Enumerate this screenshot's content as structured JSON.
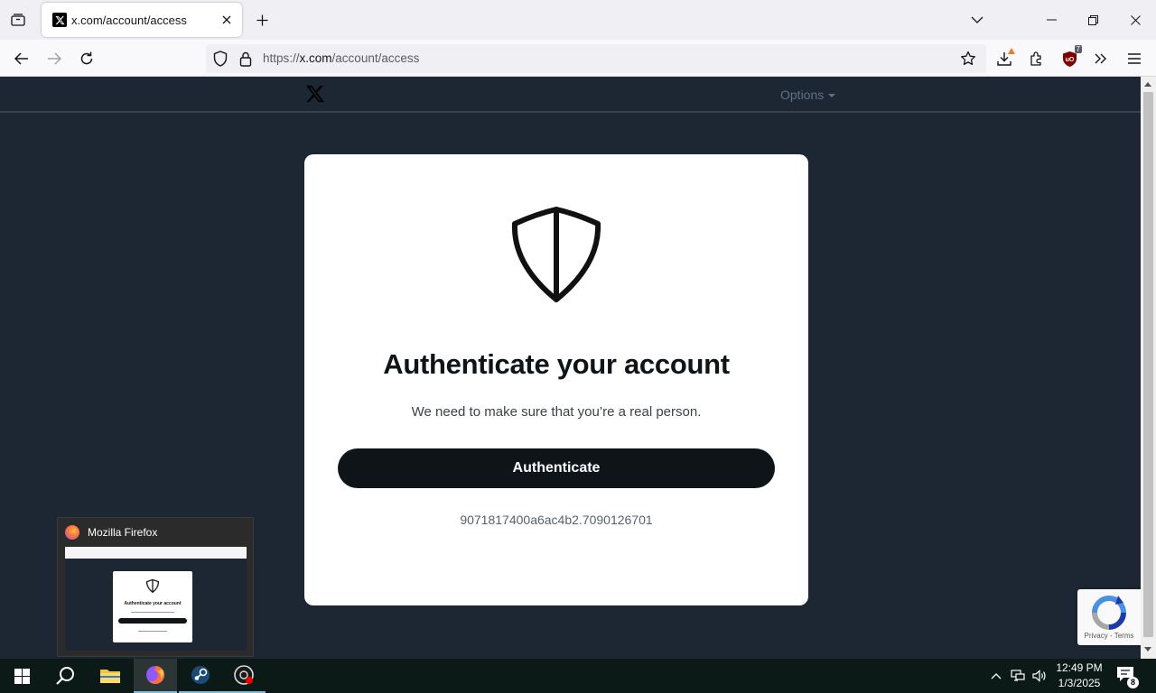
{
  "browser": {
    "tab": {
      "title": "x.com/account/access"
    },
    "url": {
      "scheme": "https://",
      "host": "x.com",
      "path": "/account/access"
    },
    "extensions": {
      "ublock_badge": "7"
    }
  },
  "site": {
    "options_label": "Options"
  },
  "card": {
    "title": "Authenticate your account",
    "subtitle": "We need to make sure that you’re a real person.",
    "button_label": "Authenticate",
    "ray_id": "9071817400a6ac4b2.7090126701"
  },
  "recaptcha": {
    "links": "Privacy - Terms"
  },
  "preview": {
    "app_title": "Mozilla Firefox",
    "card_title": "Authenticate your account"
  },
  "taskbar": {
    "time": "12:49 PM",
    "date": "1/3/2025",
    "notification_count": "8"
  },
  "colors": {
    "page_bg": "#1c2733",
    "card_bg": "#ffffff",
    "button_bg": "#0f1419",
    "taskbar_bg": "#0c1a17"
  }
}
